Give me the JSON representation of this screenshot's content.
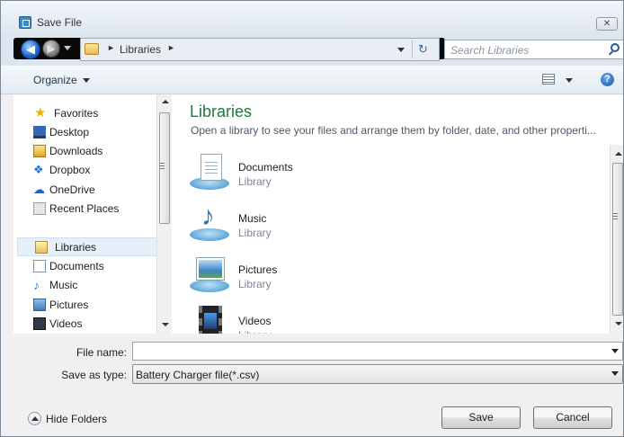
{
  "window": {
    "title": "Save File",
    "close_glyph": "✕"
  },
  "nav": {
    "back_glyph": "◀",
    "forward_glyph": "▶",
    "breadcrumb": [
      "Libraries"
    ],
    "separator": "►",
    "refresh_glyph": "↻",
    "search_placeholder": "Search Libraries"
  },
  "toolbar": {
    "organize_label": "Organize",
    "help_glyph": "?"
  },
  "sidebar": {
    "items": [
      {
        "label": "Favorites",
        "icon": "star-icon",
        "glyph": "★"
      },
      {
        "label": "Desktop",
        "icon": "desktop-icon"
      },
      {
        "label": "Downloads",
        "icon": "downloads-folder-icon"
      },
      {
        "label": "Dropbox",
        "icon": "dropbox-icon",
        "glyph": "❖"
      },
      {
        "label": "OneDrive",
        "icon": "onedrive-icon",
        "glyph": "☁"
      },
      {
        "label": "Recent Places",
        "icon": "recent-places-icon"
      },
      {
        "label": "Libraries",
        "icon": "libraries-icon",
        "selected": true
      },
      {
        "label": "Documents",
        "icon": "documents-icon"
      },
      {
        "label": "Music",
        "icon": "music-icon",
        "glyph": "♪"
      },
      {
        "label": "Pictures",
        "icon": "pictures-icon"
      },
      {
        "label": "Videos",
        "icon": "videos-icon"
      }
    ]
  },
  "content": {
    "heading": "Libraries",
    "description": "Open a library to see your files and arrange them by folder, date, and other properti...",
    "libraries": [
      {
        "name": "Documents",
        "type": "Library",
        "icon": "documents-library-icon"
      },
      {
        "name": "Music",
        "type": "Library",
        "icon": "music-library-icon",
        "glyph": "♪"
      },
      {
        "name": "Pictures",
        "type": "Library",
        "icon": "pictures-library-icon"
      },
      {
        "name": "Videos",
        "type": "Library",
        "icon": "videos-library-icon"
      }
    ]
  },
  "form": {
    "file_name_label": "File name:",
    "file_name_value": "",
    "save_as_type_label": "Save as type:",
    "save_as_type_value": "Battery Charger file(*.csv)"
  },
  "footer": {
    "hide_folders_label": "Hide Folders",
    "save_label": "Save",
    "cancel_label": "Cancel"
  },
  "colors": {
    "heading": "#1e7a3b",
    "accent": "#1a63c7",
    "selected_bg": "#e5f0fb"
  }
}
